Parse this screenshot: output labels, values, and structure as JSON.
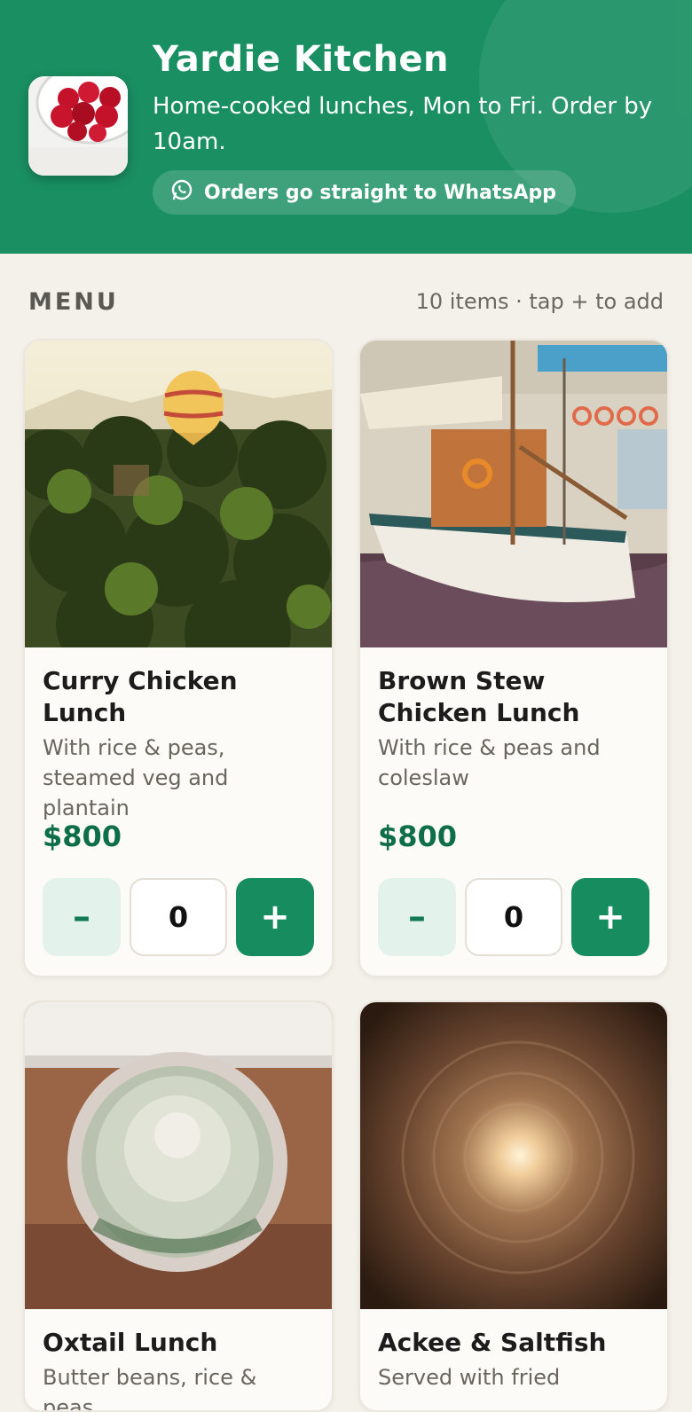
{
  "header": {
    "brand": "Yardie Kitchen",
    "tagline": "Home-cooked lunches, Mon to Fri. Order by 10am.",
    "whatsapp_label": "Orders go straight to WhatsApp",
    "icons": {
      "logo": "raspberries-bowl-image",
      "whatsapp": "whatsapp-icon"
    }
  },
  "menu": {
    "title": "MENU",
    "hint": "10 items · tap + to add"
  },
  "items": [
    {
      "name": "Curry Chicken Lunch",
      "desc": "With rice & peas, steamed veg and plantain",
      "price": "$800",
      "qty": "0",
      "minus": "–",
      "plus": "+",
      "photo": "hot-air-balloon-over-palms"
    },
    {
      "name": "Brown Stew Chicken Lunch",
      "desc": "With rice & peas and coleslaw",
      "price": "$800",
      "qty": "0",
      "minus": "–",
      "plus": "+",
      "photo": "moored-sailboat"
    },
    {
      "name": "Oxtail Lunch",
      "desc": "Butter beans, rice & peas",
      "photo": "potted-cactus"
    },
    {
      "name": "Ackee & Saltfish",
      "desc": "Served with fried",
      "photo": "light-tunnel"
    }
  ],
  "colors": {
    "brand_green": "#1a8f62",
    "price_green": "#0f6e4a",
    "background": "#f4f1ea"
  }
}
